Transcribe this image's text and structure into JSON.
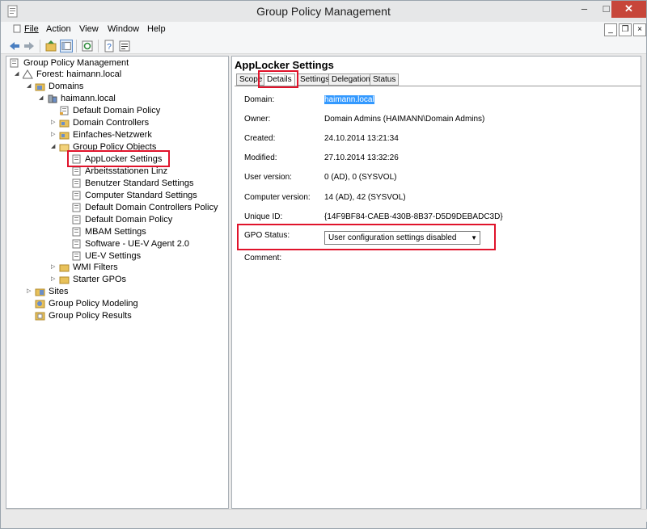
{
  "window": {
    "title": "Group Policy Management",
    "minimize": "–",
    "maximize": "□",
    "close": "✕"
  },
  "menu": {
    "items": [
      "File",
      "Action",
      "View",
      "Window",
      "Help"
    ]
  },
  "mdi": {
    "minimize": "_",
    "restore": "❐",
    "close": "×"
  },
  "tree": {
    "root": "Group Policy Management",
    "forest": "Forest: haimann.local",
    "domains": "Domains",
    "domain": "haimann.local",
    "default_domain_policy": "Default Domain Policy",
    "domain_controllers": "Domain Controllers",
    "einfaches_netzwerk": "Einfaches-Netzwerk",
    "gpo_folder": "Group Policy Objects",
    "gpos": [
      "AppLocker Settings",
      "Arbeitsstationen Linz",
      "Benutzer Standard Settings",
      "Computer Standard Settings",
      "Default Domain Controllers Policy",
      "Default Domain Policy",
      "MBAM Settings",
      "Software - UE-V Agent 2.0",
      "UE-V Settings"
    ],
    "wmi_filters": "WMI Filters",
    "starter_gpos": "Starter GPOs",
    "sites": "Sites",
    "modeling": "Group Policy Modeling",
    "results": "Group Policy Results"
  },
  "details": {
    "heading": "AppLocker Settings",
    "tabs": [
      "Scope",
      "Details",
      "Settings",
      "Delegation",
      "Status"
    ],
    "active_tab": "Details",
    "domain_label": "Domain:",
    "domain_value": "haimann.local",
    "owner_label": "Owner:",
    "owner_value": "Domain Admins (HAIMANN\\Domain Admins)",
    "created_label": "Created:",
    "created_value": "24.10.2014 13:21:34",
    "modified_label": "Modified:",
    "modified_value": "27.10.2014 13:32:26",
    "user_version_label": "User version:",
    "user_version_value": "0 (AD), 0 (SYSVOL)",
    "computer_version_label": "Computer version:",
    "computer_version_value": "14 (AD), 42 (SYSVOL)",
    "unique_id_label": "Unique ID:",
    "unique_id_value": "{14F9BF84-CAEB-430B-8B37-D5D9DEBADC3D}",
    "gpo_status_label": "GPO Status:",
    "gpo_status_value": "User configuration settings disabled",
    "comment_label": "Comment:"
  },
  "colors": {
    "highlight": "#e0132b",
    "selection": "#3399ff",
    "close_button": "#c7463a"
  }
}
